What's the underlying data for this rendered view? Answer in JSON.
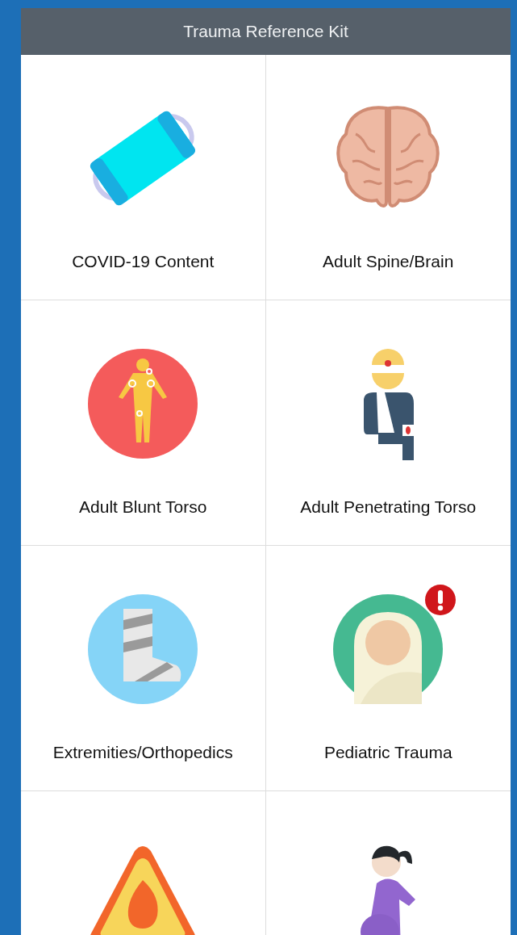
{
  "header": {
    "title": "Trauma Reference Kit"
  },
  "tiles": [
    {
      "kind": "mask",
      "label": "COVID-19 Content",
      "alert": false
    },
    {
      "kind": "brain",
      "label": "Adult Spine/Brain",
      "alert": false
    },
    {
      "kind": "body",
      "label": "Adult Blunt Torso",
      "alert": false
    },
    {
      "kind": "injured",
      "label": "Adult Penetrating Torso",
      "alert": false
    },
    {
      "kind": "cast",
      "label": "Extremities/Orthopedics",
      "alert": false
    },
    {
      "kind": "baby",
      "label": "Pediatric Trauma",
      "alert": true
    },
    {
      "kind": "fire",
      "alert": false
    },
    {
      "kind": "pregnant",
      "alert": false
    }
  ]
}
